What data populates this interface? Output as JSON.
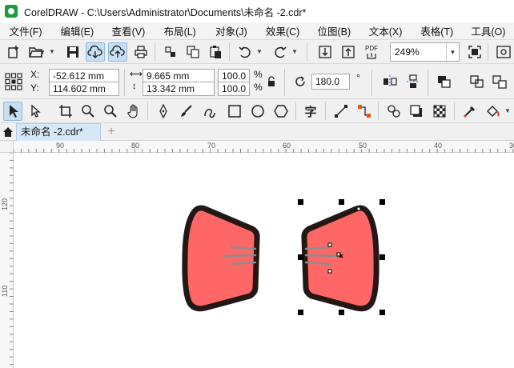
{
  "window": {
    "title": "CorelDRAW - C:\\Users\\Administrator\\Documents\\未命名 -2.cdr*"
  },
  "menu": [
    "文件(F)",
    "编辑(E)",
    "查看(V)",
    "布局(L)",
    "对象(J)",
    "效果(C)",
    "位图(B)",
    "文本(X)",
    "表格(T)",
    "工具(O)"
  ],
  "toolbar": {
    "zoom_value": "249%",
    "pdf_label": "PDF",
    "icons": [
      "new-document-icon",
      "open-folder-icon",
      "save-icon",
      "cloud-download-icon",
      "cloud-upload-icon",
      "print-icon",
      "cut-icon",
      "copy-icon",
      "paste-icon",
      "undo-icon",
      "redo-icon",
      "import-icon",
      "export-icon",
      "publish-pdf-icon",
      "zoom-fit-icon",
      "options-icon"
    ]
  },
  "property_bar": {
    "x_label": "X:",
    "y_label": "Y:",
    "x_value": "-52.612 mm",
    "y_value": "114.602 mm",
    "width_value": "9.665 mm",
    "height_value": "13.342 mm",
    "scale_x": "100.0",
    "scale_y": "100.0",
    "percent": "%",
    "rotation": "180.0",
    "degree": "°"
  },
  "toolbox": {
    "text_tool_label": "字",
    "tools": [
      "pick-tool-icon",
      "shape-tool-icon",
      "crop-tool-icon",
      "zoom-tool-icon",
      "zoom-out-icon",
      "pan-tool-icon",
      "pen-tool-icon",
      "brush-tool-icon",
      "freehand-tool-icon",
      "rectangle-tool-icon",
      "ellipse-tool-icon",
      "polygon-tool-icon",
      "text-tool-icon",
      "line-tool-icon",
      "connector-tool-icon",
      "blend-tool-icon",
      "shadow-tool-icon",
      "transparency-tool-icon",
      "eyedropper-tool-icon",
      "fill-tool-icon"
    ]
  },
  "tabs": {
    "document": "未命名 -2.cdr*",
    "add": "+"
  },
  "rulers": {
    "horizontal": [
      "90",
      "80",
      "70",
      "60",
      "50",
      "40",
      "30"
    ],
    "vertical": [
      "120",
      "110"
    ]
  },
  "colors": {
    "shape_fill": "#ff6666",
    "shape_outline": "#231815",
    "stroke_lines": "#8c8c8c",
    "tab_active": "#d6e8f7",
    "pressed_button": "#c8dff2"
  }
}
